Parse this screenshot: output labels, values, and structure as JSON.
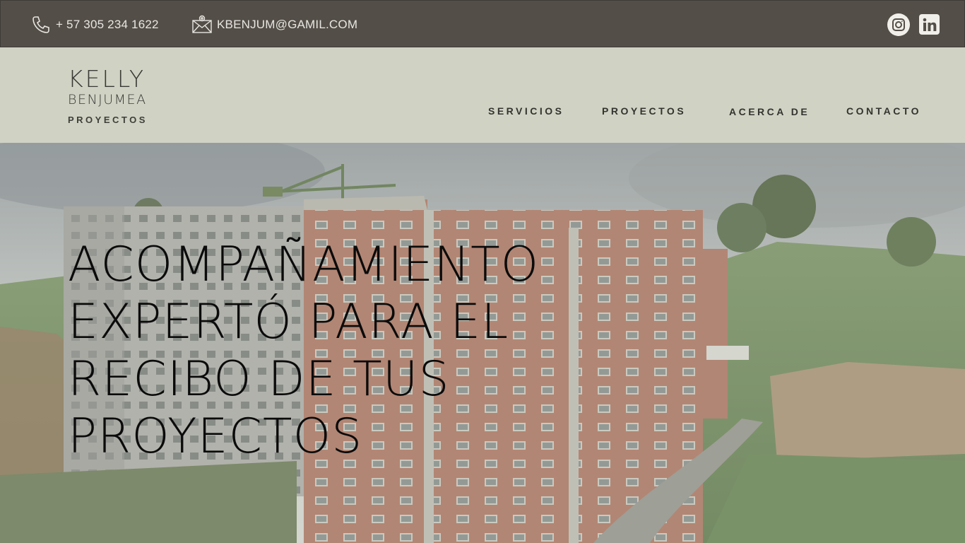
{
  "topbar": {
    "phone": "+ 57 305 234 1622",
    "email": "KBENJUM@GAMIL.COM",
    "phone_icon": "phone-icon",
    "email_icon": "mail-icon",
    "social": [
      "instagram-icon",
      "linkedin-icon"
    ]
  },
  "logo": {
    "line1": "KELLY",
    "line2": "BENJUMEA",
    "line3": "PROYECTOS"
  },
  "nav": {
    "servicios": "SERVICIOS",
    "proyectos": "PROYECTOS",
    "acerca": "ACERCA DE",
    "contacto": "CONTACTO"
  },
  "hero": {
    "headline": [
      "ACOMPAÑAMIENTO",
      "EXPERTÓ PARA EL",
      "RECIBO DE TUS",
      "PROYECTOS"
    ]
  },
  "colors": {
    "topbar": "#534e48",
    "header": "#d0d3c4",
    "text_dark": "#0b0b0b"
  }
}
